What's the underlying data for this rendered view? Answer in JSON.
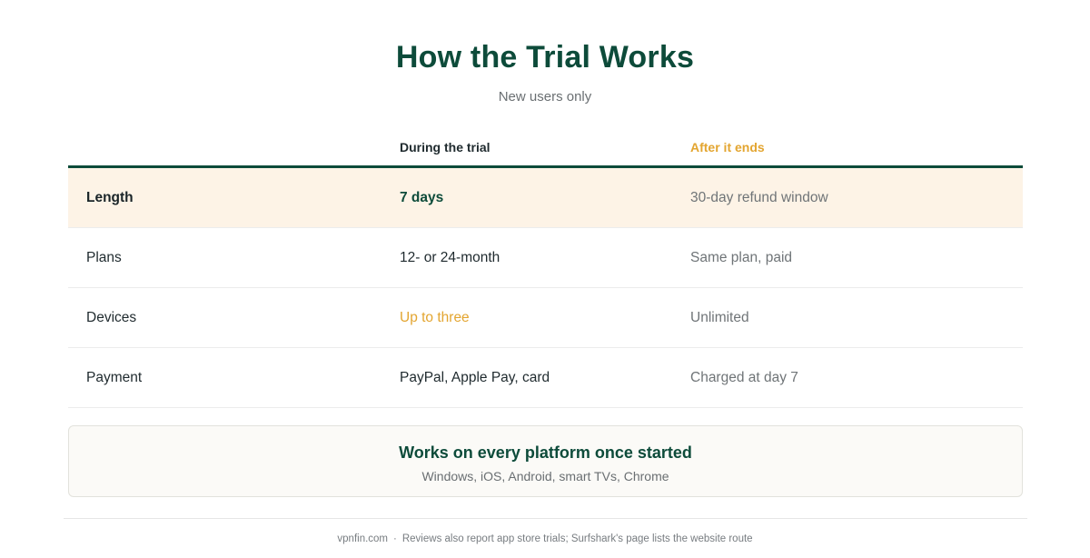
{
  "header": {
    "title": "How the Trial Works",
    "subtitle": "New users only"
  },
  "table": {
    "columns": [
      "",
      "During the trial",
      "After it ends"
    ],
    "rows": [
      {
        "label": "Length",
        "during": "7 days",
        "after": "30-day refund window"
      },
      {
        "label": "Plans",
        "during": "12- or 24-month",
        "after": "Same plan, paid"
      },
      {
        "label": "Devices",
        "during": "Up to three",
        "after": "Unlimited"
      },
      {
        "label": "Payment",
        "during": "PayPal, Apple Pay, card",
        "after": "Charged at day 7"
      }
    ]
  },
  "note": {
    "title": "Works on every platform once started",
    "subtitle": "Windows, iOS, Android, smart TVs, Chrome"
  },
  "footer": {
    "site": "vpnfin.com",
    "separator": "·",
    "text": "Reviews also report app store trials; Surfshark's page lists the website route"
  },
  "colors": {
    "brand_green": "#0d4b3a",
    "accent_orange": "#e3a530",
    "highlight_row": "#fdf3e6"
  }
}
